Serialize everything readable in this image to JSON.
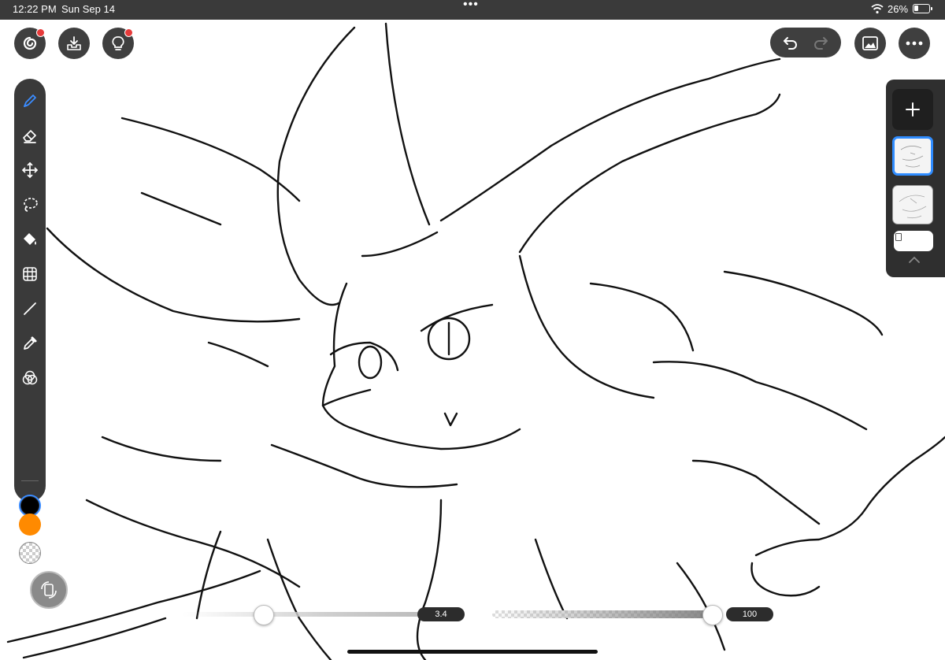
{
  "status_bar": {
    "time": "12:22 PM",
    "date": "Sun Sep 14",
    "multitask_dots": "•••",
    "battery_percent": "26%",
    "wifi_icon": "wifi-icon",
    "battery_icon": "battery-icon"
  },
  "top_left_buttons": [
    {
      "name": "gallery-button",
      "icon": "spiral-logo-icon",
      "badge": true
    },
    {
      "name": "export-button",
      "icon": "tray-download-icon",
      "badge": false
    },
    {
      "name": "tips-button",
      "icon": "lightbulb-icon",
      "badge": true
    }
  ],
  "top_right_buttons": {
    "undo_icon": "undo-icon",
    "redo_icon": "redo-icon",
    "redo_enabled": false,
    "reference_icon": "image-icon",
    "more_icon": "ellipsis-icon"
  },
  "tools": [
    {
      "name": "brush",
      "icon": "brush-icon",
      "active": true
    },
    {
      "name": "eraser",
      "icon": "eraser-icon",
      "active": false
    },
    {
      "name": "transform",
      "icon": "move-arrows-icon",
      "active": false
    },
    {
      "name": "lasso",
      "icon": "lasso-icon",
      "active": false
    },
    {
      "name": "fill",
      "icon": "paint-bucket-icon",
      "active": false
    },
    {
      "name": "grid",
      "icon": "grid-icon",
      "active": false
    },
    {
      "name": "line",
      "icon": "line-icon",
      "active": false
    },
    {
      "name": "eyedropper",
      "icon": "eyedropper-icon",
      "active": false
    },
    {
      "name": "color-mixer",
      "icon": "color-circles-icon",
      "active": false
    }
  ],
  "colors": {
    "primary": "#000000",
    "secondary": "#ff8a00",
    "transparent": "transparent",
    "accent": "#2f8cff"
  },
  "layers": {
    "add_icon": "plus-icon",
    "items": [
      {
        "name": "layer-1",
        "selected": true
      },
      {
        "name": "layer-2",
        "selected": false
      }
    ],
    "paper_color": "#ffffff",
    "collapse_icon": "chevron-up-icon"
  },
  "sliders": {
    "size_value": "3.4",
    "opacity_value": "100"
  },
  "rotate_icon": "rotate-screen-icon"
}
